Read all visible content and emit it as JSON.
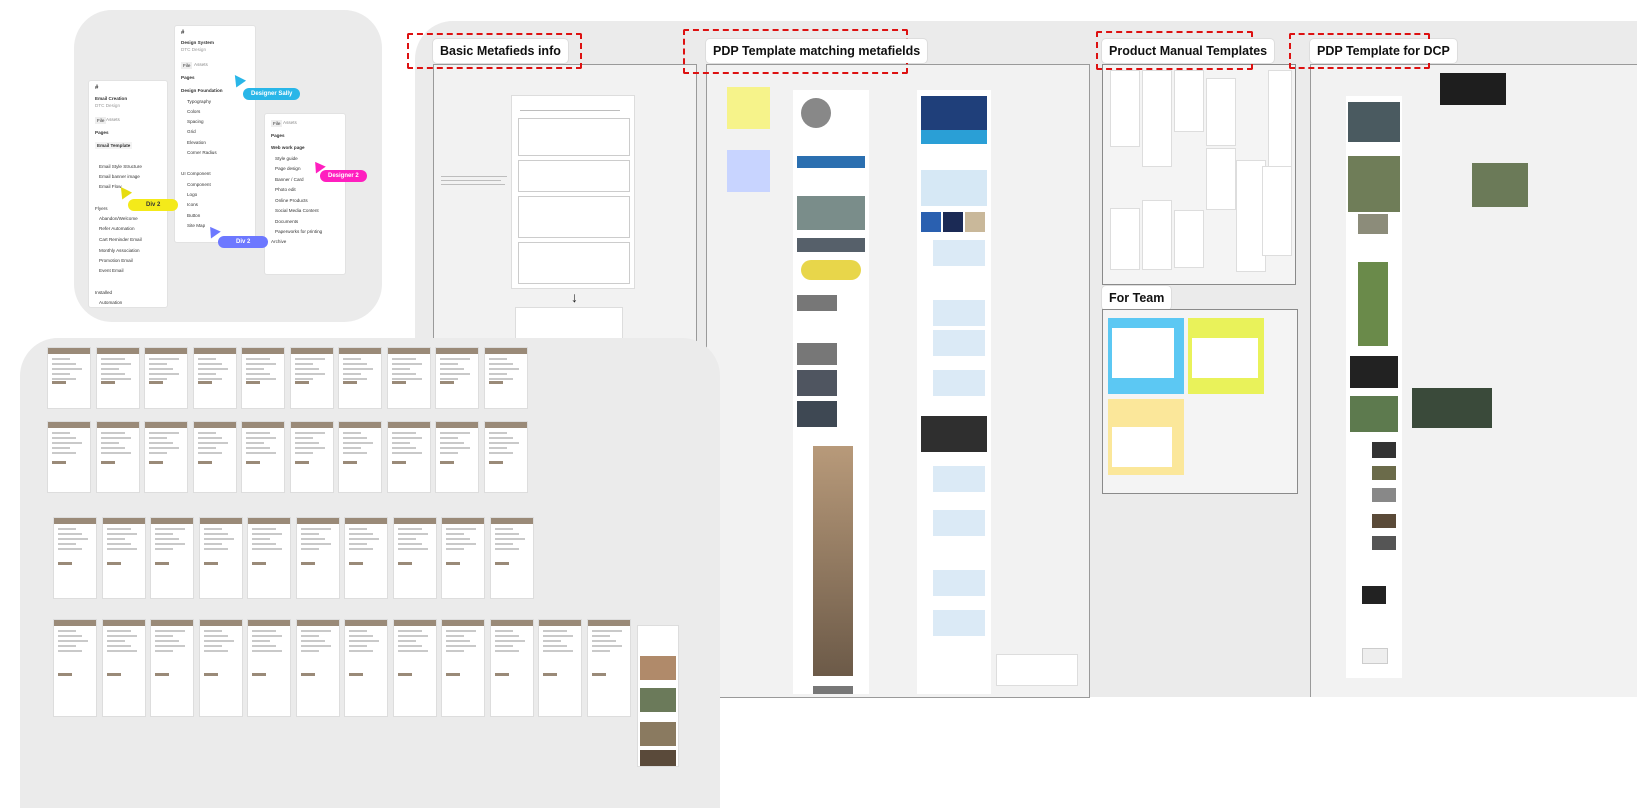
{
  "sections": {
    "basic_metafields": "Basic Metafieds info",
    "pdp_matching": "PDP Template matching metafields",
    "product_manual": "Product Manual Templates",
    "pdp_dcp": "PDP Template for DCP",
    "for_team": "For Team"
  },
  "panel_email": {
    "file_title": "Email Creation",
    "file_sub": "DTC Design",
    "tab_file": "File",
    "tab_assets": "Assets",
    "pages_label": "Pages",
    "page_current": "Email Template",
    "items": [
      "Email Style Structure",
      "Email banner image",
      "Email Flow"
    ],
    "flows_label": "Flyers",
    "flows": [
      "Abandon/Welcome",
      "Refer Automation",
      "Cart Reminder Email",
      "Monthly Association",
      "Promotion Email",
      "Event Email"
    ],
    "bottom_label": "Installed",
    "bottom_item": "Automation"
  },
  "panel_design": {
    "file_title": "Design System",
    "file_sub": "DTC Design",
    "tab_file": "File",
    "tab_assets": "Assets",
    "pages_label": "Pages",
    "group_label": "Design Foundation",
    "items": [
      "Typography",
      "Colors",
      "Spacing",
      "Grid",
      "Elevation",
      "Corner Radius"
    ],
    "group2_label": "UI Component",
    "items2": [
      "Component",
      "Logo",
      "Icons",
      "Button",
      "Site Map"
    ]
  },
  "panel_web": {
    "tab_file": "File",
    "tab_assets": "Assets",
    "pages_label": "Pages",
    "group_label": "Web work page",
    "items": [
      "Style guide",
      "Page design",
      "Banner / Card",
      "Photo edit",
      "Online Products",
      "Social Media Content",
      "Documents",
      "Paperworks for printing"
    ],
    "archive": "Archive"
  },
  "cursor_tags": {
    "designer_sally": "Designer Sally",
    "designer_2": "Designer 2",
    "div_2_a": "Div 2",
    "div_2_b": "Div 2"
  },
  "colors": {
    "dashed_border": "#dd1111",
    "tag_sally": "#29b6e8",
    "tag_designer2": "#ff1fbf",
    "tag_div2_yellow": "#f4ea1a",
    "tag_div2_blue": "#6d78ff",
    "email_header": "#9a8a78",
    "sticky_blue": "#5cc8f3",
    "sticky_yellow": "#e9f25a",
    "sticky_cream": "#fbe79a"
  }
}
